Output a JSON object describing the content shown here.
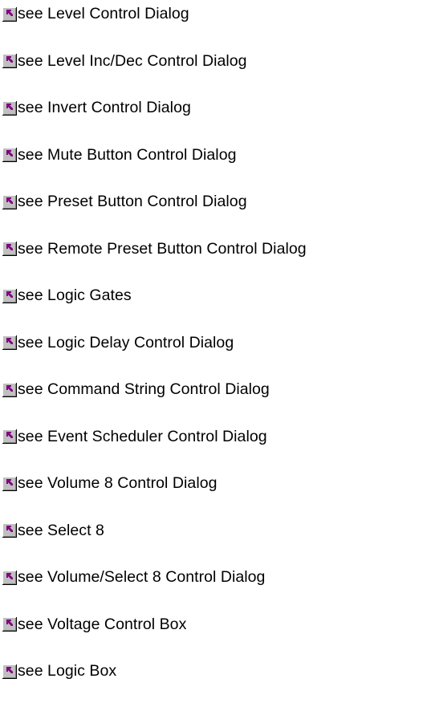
{
  "colors": {
    "icon_face": "#c0c0c0",
    "icon_highlight": "#ffffff",
    "icon_shadow": "#808080",
    "icon_dark": "#000000",
    "icon_arrow": "#800080",
    "text": "#000000",
    "background": "#ffffff"
  },
  "icon": "jump-arrow-icon",
  "links": [
    {
      "label": "see Level Control Dialog"
    },
    {
      "label": "see Level Inc/Dec Control Dialog"
    },
    {
      "label": "see Invert Control Dialog"
    },
    {
      "label": "see Mute Button Control Dialog"
    },
    {
      "label": "see Preset Button Control Dialog"
    },
    {
      "label": "see Remote Preset Button Control Dialog"
    },
    {
      "label": "see Logic Gates"
    },
    {
      "label": "see Logic Delay Control Dialog"
    },
    {
      "label": "see Command String Control Dialog"
    },
    {
      "label": "see Event Scheduler Control Dialog"
    },
    {
      "label": "see Volume 8 Control Dialog"
    },
    {
      "label": "see Select 8"
    },
    {
      "label": "see Volume/Select 8 Control Dialog"
    },
    {
      "label": "see Voltage Control Box"
    },
    {
      "label": "see Logic Box"
    }
  ]
}
